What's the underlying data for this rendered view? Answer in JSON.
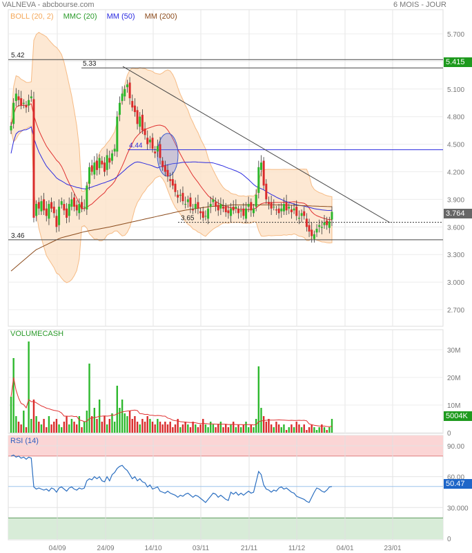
{
  "header": {
    "title": "VALNEVA - abcbourse.com",
    "period": "6 MOIS - JOUR"
  },
  "legend": [
    {
      "label": "BOLL (20, 2)",
      "color": "#f5a85a"
    },
    {
      "label": "MMC (20)",
      "color": "#2a9a2a"
    },
    {
      "label": "MM (50)",
      "color": "#2a2ae0"
    },
    {
      "label": "MM (200)",
      "color": "#8b4a1a"
    }
  ],
  "badges": {
    "last_price": "5.415",
    "current": "3.764",
    "volume": "5004K",
    "rsi": "50.47"
  },
  "volume_title": "VOLUMECASH",
  "rsi_title": "RSI (14)",
  "chart_data": [
    {
      "type": "candlestick",
      "title": "VALNEVA",
      "y_ticks": [
        "5.700",
        "5.400",
        "5.100",
        "4.800",
        "4.500",
        "4.200",
        "3.900",
        "3.600",
        "3.300",
        "3.000",
        "2.700"
      ],
      "y_tick_values": [
        5.7,
        5.4,
        5.1,
        4.8,
        4.5,
        4.2,
        3.9,
        3.6,
        3.3,
        3.0,
        2.7
      ],
      "ylim": [
        2.58,
        5.97
      ],
      "x_ticks": [
        "04/09",
        "24/09",
        "14/10",
        "03/11",
        "21/11",
        "11/12",
        "04/01",
        "23/01"
      ],
      "close": [
        4.7,
        4.95,
        5.05,
        4.98,
        4.92,
        4.95,
        4.9,
        4.98,
        5.02,
        3.7,
        3.85,
        3.8,
        3.88,
        3.78,
        3.72,
        3.85,
        3.8,
        3.75,
        3.6,
        3.82,
        3.88,
        3.78,
        3.7,
        3.85,
        3.9,
        3.82,
        3.78,
        3.85,
        3.8,
        3.82,
        4.05,
        4.25,
        4.2,
        4.3,
        4.22,
        4.35,
        4.28,
        4.2,
        4.38,
        4.3,
        4.4,
        4.45,
        4.8,
        4.95,
        5.05,
        5.1,
        5.15,
        5.0,
        4.9,
        4.85,
        4.72,
        4.8,
        4.65,
        4.6,
        4.5,
        4.55,
        4.45,
        4.4,
        4.48,
        4.35,
        4.25,
        4.2,
        4.15,
        4.1,
        4.05,
        3.98,
        3.92,
        3.95,
        3.88,
        3.85,
        3.9,
        3.82,
        3.78,
        3.85,
        3.8,
        3.75,
        3.7,
        3.72,
        3.8,
        3.85,
        3.9,
        3.82,
        3.78,
        3.85,
        3.8,
        3.76,
        3.75,
        3.8,
        3.78,
        3.82,
        3.75,
        3.78,
        3.72,
        3.8,
        3.85,
        3.78,
        3.8,
        3.95,
        4.25,
        4.3,
        4.05,
        3.9,
        3.85,
        3.8,
        3.82,
        3.78,
        3.75,
        3.8,
        3.85,
        3.78,
        3.82,
        3.76,
        3.8,
        3.72,
        3.7,
        3.75,
        3.72,
        3.6,
        3.55,
        3.5,
        3.52,
        3.58,
        3.62,
        3.6,
        3.65,
        3.62,
        3.66,
        3.764
      ],
      "mm200_keypoints": [
        3.12,
        3.35,
        3.48,
        3.55,
        3.6,
        3.66,
        3.72,
        3.78,
        3.82,
        3.84,
        3.84,
        3.84,
        3.83,
        3.82
      ],
      "annotations": [
        {
          "label": "5.42",
          "value": 5.42
        },
        {
          "label": "5.33",
          "value": 5.33
        },
        {
          "label": "4.44",
          "value": 4.44
        },
        {
          "label": "3.65",
          "value": 3.65
        },
        {
          "label": "3.46",
          "value": 3.46
        }
      ]
    },
    {
      "type": "bar",
      "title": "VOLUMECASH",
      "y_ticks": [
        "30M",
        "20M",
        "10M",
        "0"
      ],
      "y_tick_values": [
        30,
        20,
        10,
        0
      ],
      "ylim": [
        0,
        37
      ],
      "volume_m": [
        13,
        27,
        6,
        4,
        3,
        8,
        2,
        33,
        5,
        12,
        6,
        4,
        3,
        5,
        2,
        6,
        3,
        4,
        5,
        3,
        2,
        4,
        6,
        3,
        5,
        4,
        3,
        6,
        2,
        4,
        8,
        25,
        6,
        9,
        5,
        12,
        4,
        6,
        3,
        5,
        7,
        4,
        17,
        9,
        12,
        7,
        6,
        8,
        5,
        6,
        4,
        3,
        5,
        4,
        6,
        5,
        4,
        3,
        5,
        4,
        3,
        4,
        3,
        4,
        2,
        3,
        5,
        2,
        3,
        4,
        3,
        2,
        4,
        3,
        2,
        3,
        5,
        3,
        2,
        4,
        3,
        2,
        3,
        4,
        2,
        3,
        2,
        3,
        4,
        2,
        3,
        2,
        3,
        4,
        2,
        3,
        2,
        5,
        24,
        9,
        6,
        4,
        5,
        3,
        2,
        4,
        3,
        2,
        3,
        1,
        2,
        3,
        2,
        4,
        3,
        2,
        3,
        1,
        2,
        3,
        2,
        1,
        2,
        3,
        2,
        1,
        2,
        5
      ]
    },
    {
      "type": "line",
      "title": "RSI (14)",
      "y_ticks": [
        "90.00",
        "60.00",
        "30.000",
        "0"
      ],
      "y_tick_values": [
        90,
        60,
        30,
        0
      ],
      "ylim": [
        0,
        100
      ],
      "bands": {
        "overbought": 80,
        "oversold": 20
      },
      "rsi": [
        80,
        81,
        79,
        80,
        78,
        79,
        77,
        79,
        78,
        50,
        48,
        49,
        48,
        47,
        48,
        46,
        49,
        48,
        45,
        49,
        50,
        48,
        46,
        49,
        50,
        48,
        47,
        49,
        48,
        49,
        56,
        58,
        57,
        60,
        58,
        60,
        56,
        55,
        60,
        56,
        62,
        64,
        68,
        70,
        71,
        68,
        66,
        62,
        58,
        60,
        56,
        58,
        55,
        54,
        50,
        52,
        48,
        49,
        50,
        46,
        45,
        44,
        46,
        44,
        43,
        42,
        40,
        42,
        41,
        43,
        44,
        42,
        40,
        42,
        41,
        39,
        37,
        35,
        38,
        41,
        44,
        43,
        40,
        42,
        40,
        38,
        37,
        45,
        43,
        45,
        42,
        44,
        42,
        44,
        46,
        44,
        45,
        55,
        65,
        62,
        52,
        48,
        47,
        45,
        47,
        46,
        49,
        50,
        48,
        49,
        47,
        45,
        44,
        41,
        40,
        39,
        38,
        36,
        35,
        40,
        45,
        49,
        48,
        46,
        45,
        47,
        50,
        50.47
      ]
    }
  ]
}
